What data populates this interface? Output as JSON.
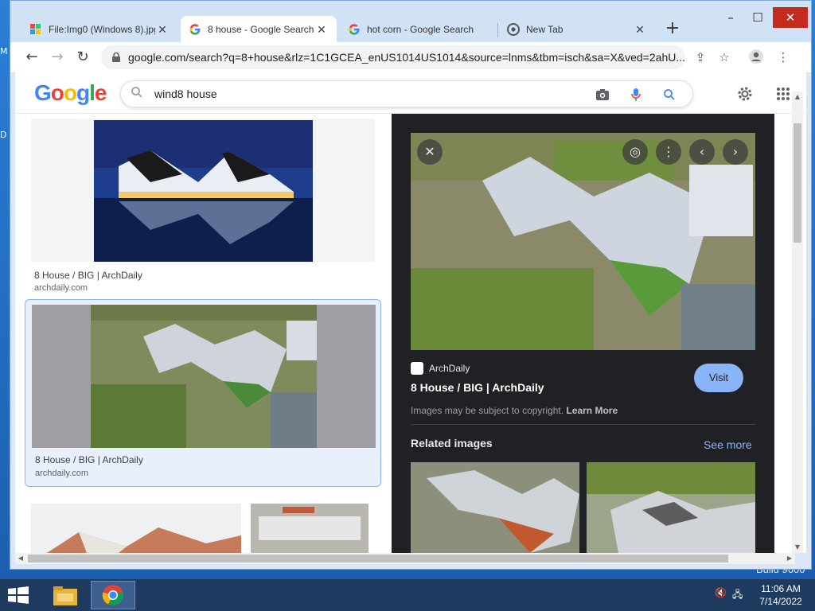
{
  "desktop": {
    "edge_text_1": "M",
    "edge_text_2": "D",
    "build_text": "Build 9600"
  },
  "browser": {
    "tabs": [
      {
        "label": "File:Img0 (Windows 8).jpg",
        "favicon": "image-file-icon"
      },
      {
        "label": "8 house - Google Search",
        "favicon": "google-g-icon",
        "active": true
      },
      {
        "label": "hot corn - Google Search",
        "favicon": "google-g-icon"
      },
      {
        "label": "New Tab",
        "favicon": "chrome-icon"
      }
    ],
    "window_controls": {
      "minimize": "–",
      "maximize": "☐",
      "close": "✕"
    },
    "url": "google.com/search?q=8+house&rlz=1C1GCEA_enUS1014US1014&source=lnms&tbm=isch&sa=X&ved=2ahU..."
  },
  "google": {
    "logo_letters": [
      "G",
      "o",
      "o",
      "g",
      "l",
      "e"
    ],
    "logo_colors": [
      "#4285F4",
      "#EA4335",
      "#FBBC05",
      "#4285F4",
      "#34A853",
      "#EA4335"
    ],
    "search_value": "wind8 house"
  },
  "results": [
    {
      "title": "8 House / BIG | ArchDaily",
      "source": "archdaily.com"
    },
    {
      "title": "8 House / BIG | ArchDaily",
      "source": "archdaily.com",
      "selected": true
    }
  ],
  "viewer": {
    "source_name": "ArchDaily",
    "title": "8 House / BIG | ArchDaily",
    "visit_label": "Visit",
    "copyright_text": "Images may be subject to copyright.",
    "learn_more": "Learn More",
    "related_label": "Related images",
    "see_more": "See more"
  },
  "taskbar": {
    "time": "11:06 AM",
    "date": "7/14/2022"
  },
  "colors": {
    "accent": "#8ab4f8",
    "viewer_bg": "#202124",
    "taskbar": "#1f3a5f",
    "desktop": "#2a7fd6"
  }
}
